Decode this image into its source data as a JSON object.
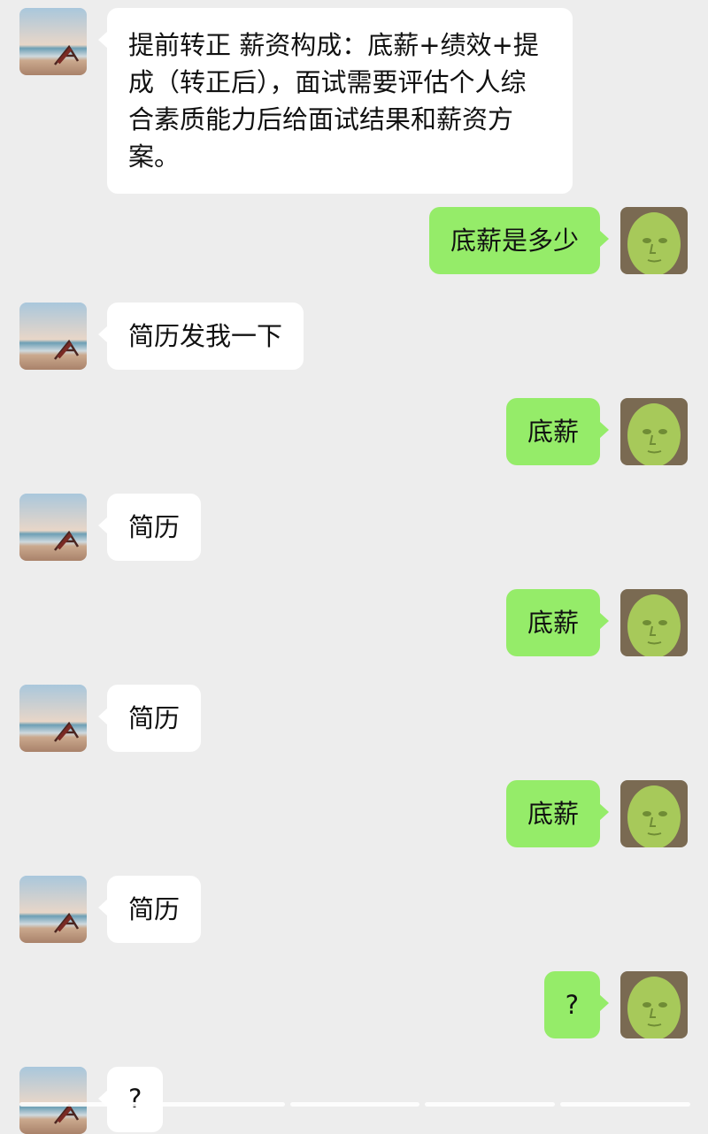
{
  "messages": [
    {
      "side": "left",
      "text": "提前转正 薪资构成：底薪+绩效+提成（转正后），面试需要评估个人综合素质能力后给面试结果和薪资方案。"
    },
    {
      "side": "right",
      "text": "底薪是多少"
    },
    {
      "side": "left",
      "text": "简历发我一下"
    },
    {
      "side": "right",
      "text": "底薪"
    },
    {
      "side": "left",
      "text": "简历"
    },
    {
      "side": "right",
      "text": "底薪"
    },
    {
      "side": "left",
      "text": "简历"
    },
    {
      "side": "right",
      "text": "底薪"
    },
    {
      "side": "left",
      "text": "简历"
    },
    {
      "side": "right",
      "text": "?"
    },
    {
      "side": "left",
      "text": "?"
    }
  ],
  "avatars": {
    "left": {
      "icon": "beach-chair-avatar-icon"
    },
    "right": {
      "icon": "green-face-avatar-icon"
    }
  },
  "colors": {
    "background": "#ededed",
    "incoming_bubble": "#ffffff",
    "outgoing_bubble": "#95ec69",
    "text": "#111111"
  },
  "progress": {
    "segments": 5,
    "filled": 5
  }
}
